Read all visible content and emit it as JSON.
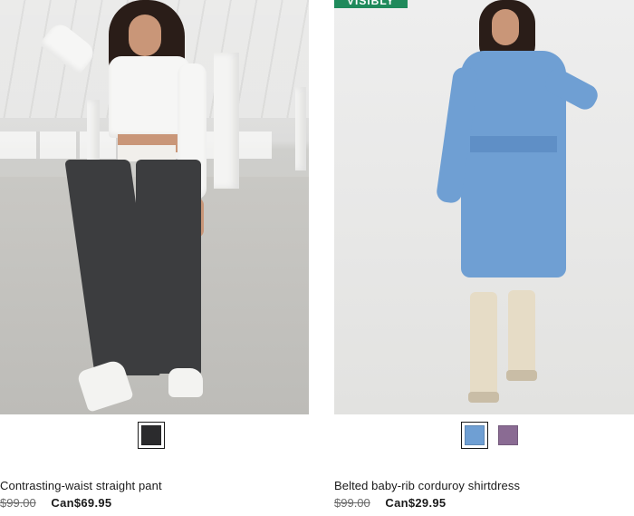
{
  "products": [
    {
      "name": "Contrasting-waist straight pant",
      "price_original": "$99.00",
      "price_sale": "Can$69.95",
      "colors": [
        {
          "hex": "#2b2b2d",
          "selected": true
        }
      ]
    },
    {
      "badge": "VISIBLY",
      "name": "Belted baby-rib corduroy shirtdress",
      "price_original": "$99.00",
      "price_sale": "Can$29.95",
      "colors": [
        {
          "hex": "#6f9fd3",
          "selected": true
        },
        {
          "hex": "#8a6b93",
          "selected": false
        }
      ]
    }
  ]
}
